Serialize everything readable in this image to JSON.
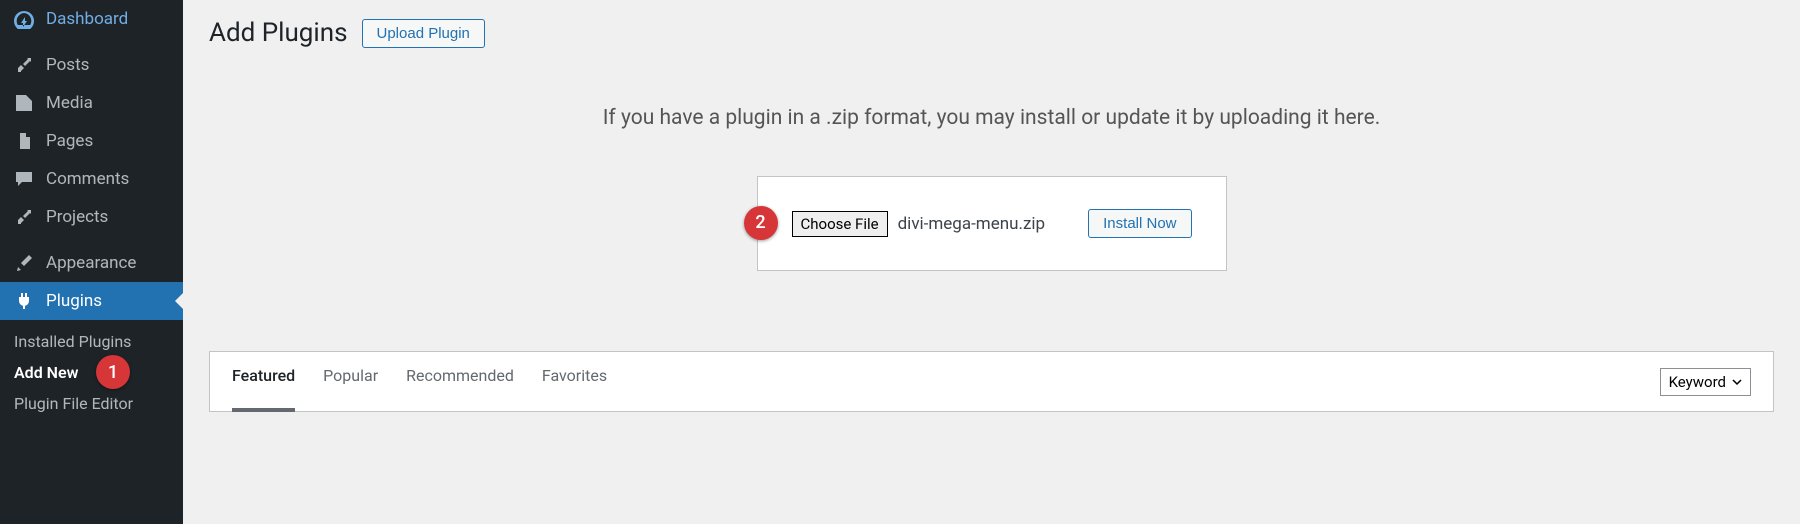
{
  "sidebar": {
    "items": [
      {
        "label": "Dashboard"
      },
      {
        "label": "Posts"
      },
      {
        "label": "Media"
      },
      {
        "label": "Pages"
      },
      {
        "label": "Comments"
      },
      {
        "label": "Projects"
      },
      {
        "label": "Appearance"
      },
      {
        "label": "Plugins"
      }
    ],
    "submenu": {
      "installed": "Installed Plugins",
      "addnew": "Add New",
      "editor": "Plugin File Editor"
    }
  },
  "header": {
    "title": "Add Plugins",
    "upload_btn": "Upload Plugin"
  },
  "upload": {
    "instruction": "If you have a plugin in a .zip format, you may install or update it by uploading it here.",
    "choose_file": "Choose File",
    "file_name": "divi-mega-menu.zip",
    "install_btn": "Install Now"
  },
  "filters": {
    "featured": "Featured",
    "popular": "Popular",
    "recommended": "Recommended",
    "favorites": "Favorites",
    "keyword": "Keyword"
  },
  "annotations": {
    "one": "1",
    "two": "2"
  }
}
